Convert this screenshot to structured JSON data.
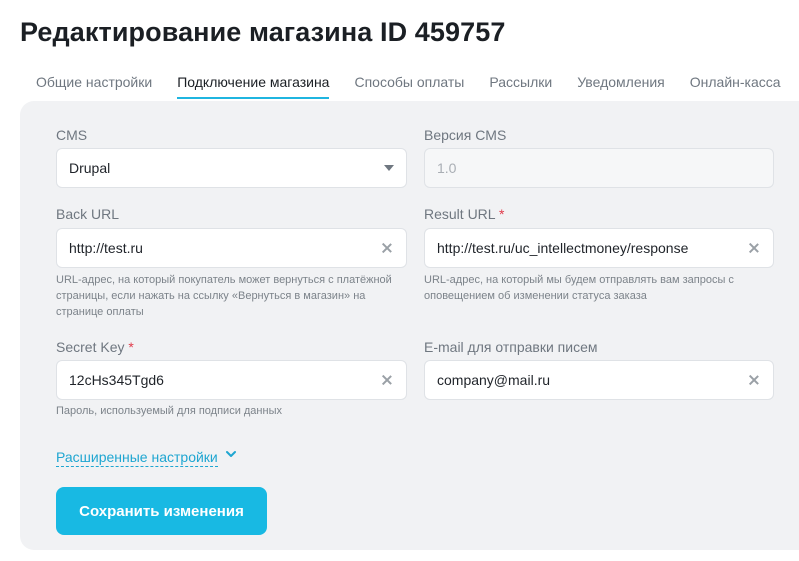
{
  "page": {
    "title": "Редактирование магазина ID 459757"
  },
  "tabs": [
    {
      "label": "Общие настройки"
    },
    {
      "label": "Подключение магазина",
      "active": true
    },
    {
      "label": "Способы оплаты"
    },
    {
      "label": "Рассылки"
    },
    {
      "label": "Уведомления"
    },
    {
      "label": "Онлайн-касса"
    }
  ],
  "form": {
    "cms": {
      "label": "CMS",
      "value": "Drupal"
    },
    "cms_version": {
      "label": "Версия CMS",
      "placeholder": "1.0"
    },
    "back_url": {
      "label": "Back URL",
      "value": "http://test.ru",
      "hint": "URL-адрес, на который покупатель может вернуться с платёжной страницы, если нажать на ссылку «Вернуться в магазин» на странице оплаты"
    },
    "result_url": {
      "label": "Result URL",
      "required": "*",
      "value": "http://test.ru/uc_intellectmoney/response",
      "hint": "URL-адрес, на который мы будем отправлять вам запросы с оповещением об изменении статуса заказа"
    },
    "secret_key": {
      "label": "Secret Key",
      "required": "*",
      "value": "12cHs345Tgd6",
      "hint": "Пароль, используемый для подписи данных"
    },
    "email": {
      "label": "E-mail для отправки писем",
      "value": "company@mail.ru"
    },
    "advanced_label": "Расширенные настройки",
    "save_label": "Сохранить изменения"
  },
  "colors": {
    "accent": "#18b9e3",
    "link": "#1fa6d1",
    "required": "#e03a4a",
    "panel": "#f1f2f4"
  },
  "icons": {
    "clear": "close-icon",
    "select": "caret-down-icon",
    "advanced": "chevron-down-icon"
  }
}
